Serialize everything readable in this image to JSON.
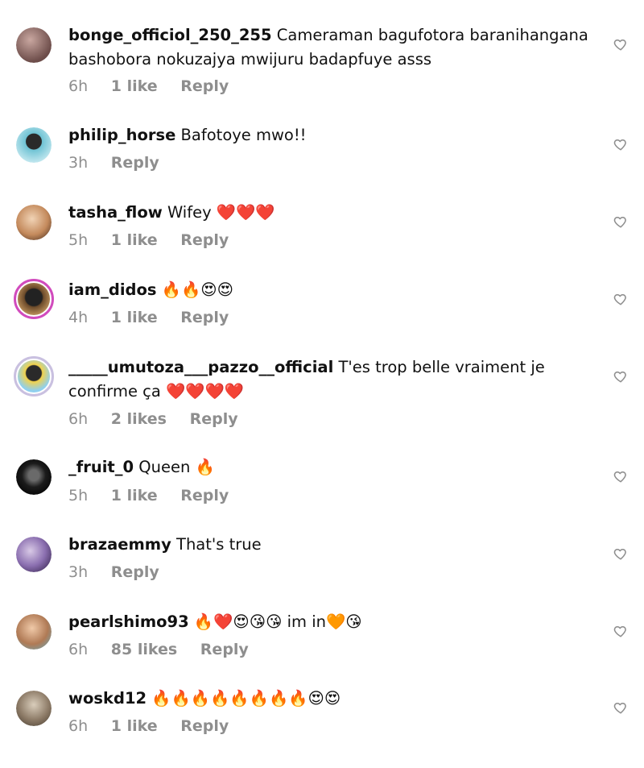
{
  "comments": [
    {
      "username": "bonge_officiol_250_255",
      "text": "Cameraman bagufotora baranihangana bashobora nokuzajya mwijuru badapfuye asss",
      "time": "6h",
      "likes": "1 like",
      "reply": "Reply",
      "avatar_color": "#8a6d6a"
    },
    {
      "username": "philip_horse",
      "text": "Bafotoye mwo!!",
      "time": "3h",
      "likes": "",
      "reply": "Reply",
      "avatar_color": "#5fb6c8"
    },
    {
      "username": "tasha_flow",
      "text": "Wifey ❤️❤️❤️",
      "time": "5h",
      "likes": "1 like",
      "reply": "Reply",
      "avatar_color": "#c9a37f"
    },
    {
      "username": "iam_didos",
      "text": "🔥🔥😍😍",
      "time": "4h",
      "likes": "1 like",
      "reply": "Reply",
      "avatar_color": "#3a3a3a"
    },
    {
      "username": "_____umutoza___pazzo__official",
      "text": "T'es trop belle vraiment je confirme ça ❤️❤️❤️❤️",
      "time": "6h",
      "likes": "2 likes",
      "reply": "Reply",
      "avatar_color": "#6fb3e0"
    },
    {
      "username": "_fruit_0",
      "text": "Queen 🔥",
      "time": "5h",
      "likes": "1 like",
      "reply": "Reply",
      "avatar_color": "#1a1a1a"
    },
    {
      "username": "brazaemmy",
      "text": "That's true",
      "time": "3h",
      "likes": "",
      "reply": "Reply",
      "avatar_color": "#7c6aa0"
    },
    {
      "username": "pearlshimo93",
      "text": "🔥❤️😍😘😘 im in🧡😘",
      "time": "6h",
      "likes": "85 likes",
      "reply": "Reply",
      "avatar_color": "#b98b6a"
    },
    {
      "username": "woskd12",
      "text": "🔥🔥🔥🔥🔥🔥🔥🔥😍😍",
      "time": "6h",
      "likes": "1 like",
      "reply": "Reply",
      "avatar_color": "#8c7a66"
    }
  ],
  "like_icon": "heart-outline-icon",
  "meta_color": "#8e8e8e"
}
